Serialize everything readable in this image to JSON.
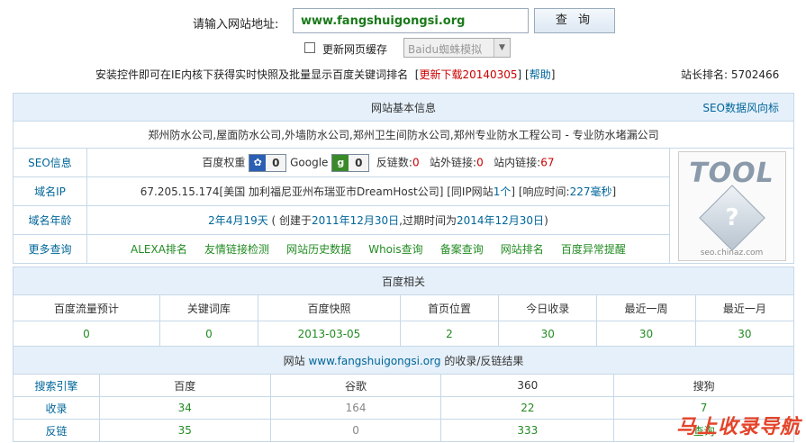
{
  "search": {
    "label": "请输入网站地址:",
    "url_value": "www.fangshuigongsi.org",
    "query_button": "查 询",
    "refresh_cache_label": "更新网页缓存",
    "spider_select": "Baidu蜘蛛模拟"
  },
  "notice": {
    "text": "安装控件即可在IE内核下获得实时快照及批量显示百度关键词排名",
    "download_link": "更新下载20140305",
    "help_link": "帮助",
    "rank_label": "站长排名:",
    "rank_value": "5702466"
  },
  "basic_info": {
    "header": "网站基本信息",
    "seo_trend_link": "SEO数据风向标",
    "site_title": "郑州防水公司,屋面防水公司,外墙防水公司,郑州卫生间防水公司,郑州专业防水工程公司 - 专业防水堵漏公司",
    "seo_label": "SEO信息",
    "baidu_weight_label": "百度权重",
    "baidu_weight_value": "0",
    "google_label": "Google",
    "google_value": "0",
    "backlinks_label": "反链数:",
    "backlinks_value": "0",
    "outlinks_label": "站外链接:",
    "outlinks_value": "0",
    "inlinks_label": "站内链接:",
    "inlinks_value": "67",
    "domain_ip_label": "域名IP",
    "ip_info": "67.205.15.174[美国 加利福尼亚州布瑞亚市DreamHost公司]",
    "same_ip_label": "[同IP网站",
    "same_ip_count": "1个",
    "same_ip_suffix": "]",
    "response_label": "[响应时间:",
    "response_value": "227毫秒",
    "response_suffix": "]",
    "domain_age_label": "域名年龄",
    "domain_age_value": "2年4月19天",
    "created_prefix": "( 创建于",
    "created_date": "2011年12月30日",
    "expire_prefix": ",过期时间为",
    "expire_date": "2014年12月30日",
    "close_paren": ")",
    "more_label": "更多查询",
    "more_links": [
      "ALEXA排名",
      "友情链接检测",
      "网站历史数据",
      "Whois查询",
      "备案查询",
      "网站排名",
      "百度异常提醒"
    ],
    "logo_text": "TOOL",
    "logo_caption": "seo.chinaz.com"
  },
  "baidu": {
    "header": "百度相关",
    "columns": [
      "百度流量预计",
      "关键词库",
      "百度快照",
      "首页位置",
      "今日收录",
      "最近一周",
      "最近一月"
    ],
    "values": [
      "0",
      "0",
      "2013-03-05",
      "2",
      "30",
      "30",
      "30"
    ]
  },
  "index": {
    "header_prefix": "网站",
    "header_site": "www.fangshuigongsi.org",
    "header_suffix": "的收录/反链结果",
    "columns": [
      "搜索引擎",
      "百度",
      "谷歌",
      "360",
      "搜狗"
    ],
    "rows": [
      {
        "label": "收录",
        "values": [
          "34",
          "164",
          "22",
          "7"
        ]
      },
      {
        "label": "反链",
        "values": [
          "35",
          "0",
          "333",
          "查询"
        ]
      }
    ]
  },
  "watermark": "马上收录导航",
  "colors": {
    "link": "#006699",
    "value_green": "#228b22",
    "value_red": "#cc0000",
    "header_bg": "#e6f0fa"
  }
}
